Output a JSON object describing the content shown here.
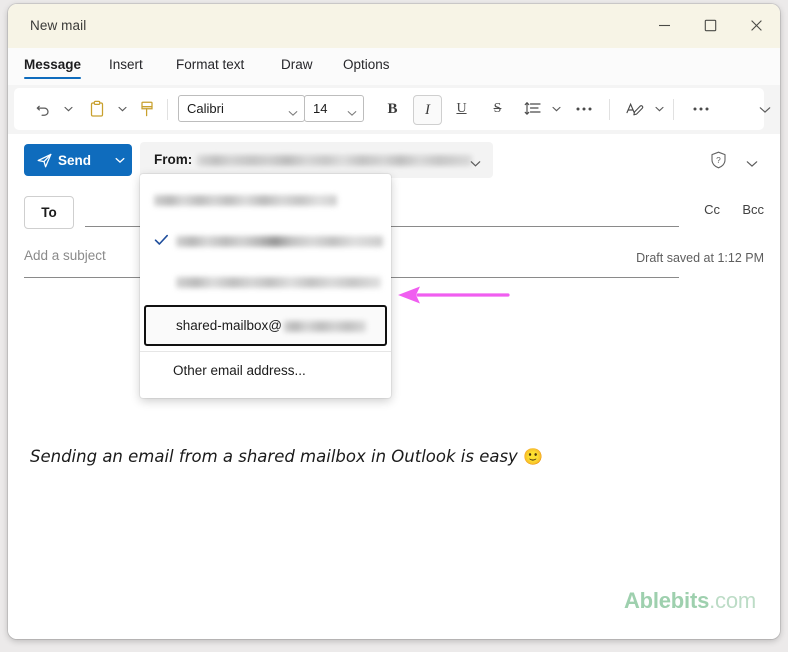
{
  "window": {
    "title": "New mail",
    "controls": {
      "minimize": "minimize-icon",
      "maximize": "maximize-icon",
      "close": "close-icon"
    }
  },
  "ribbon": {
    "tabs": [
      {
        "label": "Message",
        "active": true
      },
      {
        "label": "Insert",
        "active": false
      },
      {
        "label": "Format text",
        "active": false
      },
      {
        "label": "Draw",
        "active": false
      },
      {
        "label": "Options",
        "active": false
      }
    ],
    "toolbar": {
      "undo_icon": "undo-icon",
      "paste_icon": "paste-icon",
      "format_painter_icon": "format-painter-icon",
      "font_family": "Calibri",
      "font_size": "14",
      "bold_label": "B",
      "italic_label": "I",
      "underline_label": "U",
      "strikethrough_label": "S",
      "line_spacing_icon": "line-spacing-icon",
      "more_paragraph_icon": "more-options-icon",
      "font_color_icon": "font-color-icon",
      "more_commands_icon": "more-commands-icon",
      "collapse_icon": "chevron-down-icon"
    },
    "italic_active": true
  },
  "header": {
    "send_label": "Send",
    "send_split_icon": "chevron-down-icon",
    "send_plane_icon": "send-plane-icon",
    "from_label": "From:",
    "from_value": "",
    "from_chevron_icon": "chevron-down-icon",
    "sensitivity_icon": "shield-question-icon",
    "expand_icon": "chevron-down-icon"
  },
  "recipients": {
    "to_label": "To",
    "to_value": "",
    "cc_label": "Cc",
    "bcc_label": "Bcc"
  },
  "subject": {
    "placeholder": "Add a subject",
    "value": "",
    "draft_status": "Draft saved at 1:12 PM"
  },
  "body": {
    "text": "Sending an email from a shared mailbox in Outlook is easy ",
    "emoji": "🙂",
    "watermark_bold": "Ablebits",
    "watermark_light": ".com"
  },
  "from_dropdown": {
    "items": [
      {
        "label": "",
        "blurred": true,
        "checked": false,
        "highlighted": false
      },
      {
        "label": "",
        "blurred": true,
        "checked": true,
        "highlighted": false
      },
      {
        "label": "",
        "blurred": true,
        "checked": false,
        "highlighted": false
      },
      {
        "label": "shared-mailbox@",
        "blurred": true,
        "checked": false,
        "highlighted": true
      }
    ],
    "other_label": "Other email address...",
    "check_icon": "checkmark-icon",
    "selected_item_label": "shared-mailbox@"
  },
  "annotation": {
    "arrow_icon": "left-arrow-annotation",
    "arrow_color": "#f05ef0"
  },
  "colors": {
    "titlebar": "#f7f4e6",
    "accent_blue": "#0f6cbd",
    "tab_underline": "#0f6cbd",
    "arrow_magenta": "#f05ef0",
    "watermark_green": "#a8d5b6",
    "ribbon_gold": "#c8a02e"
  }
}
